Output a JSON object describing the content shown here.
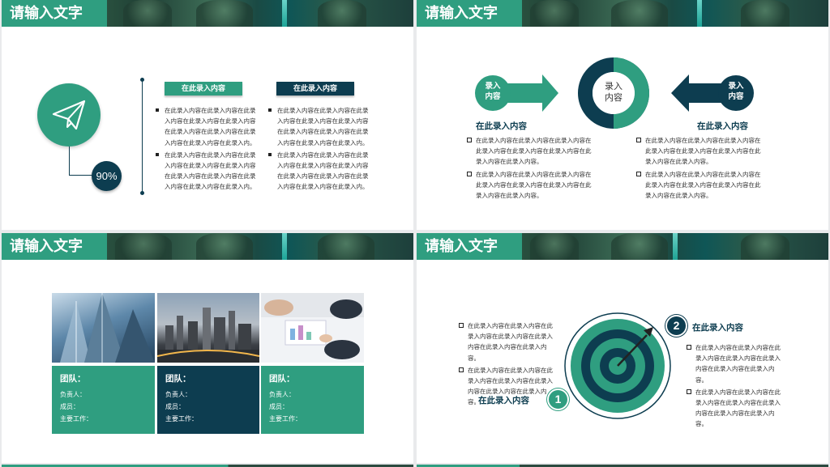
{
  "slide1": {
    "title": "请输入文字",
    "percent": "90%",
    "tag_left": "在此录入内容",
    "tag_right": "在此录入内容",
    "col_left": [
      "在此录入内容在此录入内容在此录入内容在此录入内容在此录入内容在此录入内容在此录入内容在此录入内容在此录入内容在此录入内。",
      "在此录入内容在此录入内容在此录入内容在此录入内容在此录入内容在此录入内容在此录入内容在此录入内容在此录入内容在此录入内。"
    ],
    "col_right": [
      "在此录入内容在此录入内容在此录入内容在此录入内容在此录入内容在此录入内容在此录入内容在此录入内容在此录入内容在此录入内。",
      "在此录入内容在此录入内容在此录入内容在此录入内容在此录入内容在此录入内容在此录入内容在此录入内容在此录入内容在此录入内。"
    ],
    "icon": "paper-plane-icon"
  },
  "slide2": {
    "title": "请输入文字",
    "arrow_left_label": "录入内容",
    "arrow_right_label": "录入内容",
    "donut_label": "录入内容",
    "donut_value": 0.5,
    "head_left": "在此录入内容",
    "head_right": "在此录入内容",
    "col_left": [
      "在此录入内容在此录入内容在此录入内容在此录入内容在此录入内容在此录入内容在此录入内容在此录入内容。",
      "在此录入内容在此录入内容在此录入内容在此录入内容在此录入内容在此录入内容在此录入内容在此录入内容。"
    ],
    "col_right": [
      "在此录入内容在此录入内容在此录入内容在此录入内容在此录入内容在此录入内容在此录入内容在此录入内容。",
      "在此录入内容在此录入内容在此录入内容在此录入内容在此录入内容在此录入内容在此录入内容在此录入内容。"
    ]
  },
  "slide3": {
    "title": "请输入文字",
    "cards": [
      {
        "team": "团队：",
        "lead": "负责人：",
        "members": "成员：",
        "work": "主要工作：",
        "image": "skyscrapers-photo",
        "color": "#2f9e80"
      },
      {
        "team": "团队：",
        "lead": "负责人：",
        "members": "成员：",
        "work": "主要工作：",
        "image": "city-skyline-photo",
        "color": "#0d3d50"
      },
      {
        "team": "团队：",
        "lead": "负责人：",
        "members": "成员：",
        "work": "主要工作：",
        "image": "business-meeting-photo",
        "color": "#2f9e80"
      }
    ]
  },
  "slide4": {
    "title": "请输入文字",
    "left_items": [
      "在此录入内容在此录入内容在此录入内容在此录入内容在此录入内容在此录入内容在此录入内容。",
      "在此录入内容在此录入内容在此录入内容在此录入内容在此录入内容在此录入内容在此录入内容。"
    ],
    "right_items": [
      "在此录入内容在此录入内容在此录入内容在此录入内容在此录入内容在此录入内容在此录入内容。",
      "在此录入内容在此录入内容在此录入内容在此录入内容在此录入内容在此录入内容在此录入内容。"
    ],
    "num1": "1",
    "num2": "2",
    "label1": "在此录入内容",
    "label2": "在此录入内容",
    "icon": "target-icon"
  },
  "colors": {
    "teal": "#2f9e80",
    "navy": "#0d3d50"
  }
}
